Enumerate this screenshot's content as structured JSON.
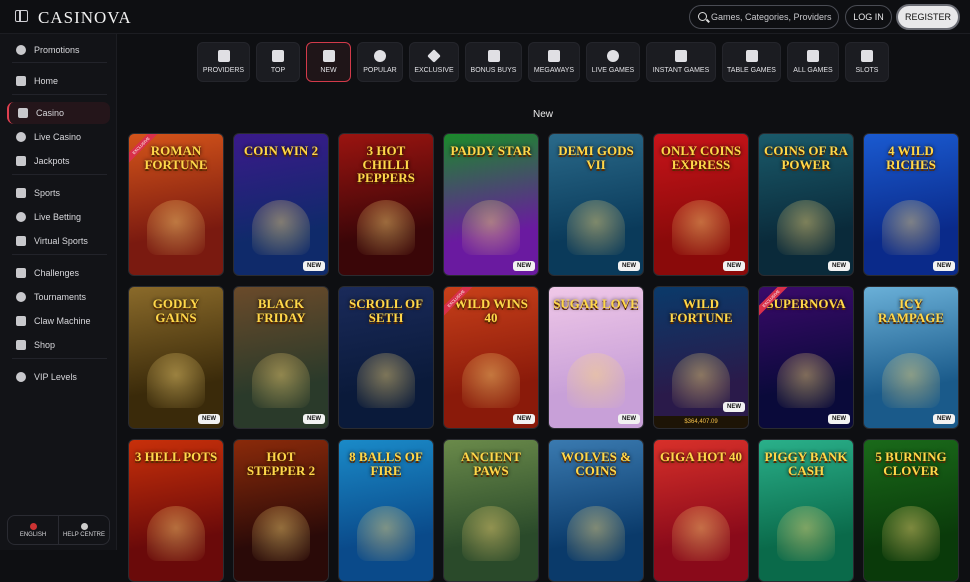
{
  "header": {
    "logo": "CASINOVA",
    "search_placeholder": "Games, Categories, Providers",
    "login": "LOG IN",
    "register": "REGISTER"
  },
  "sidebar": {
    "items": [
      {
        "label": "Promotions",
        "icon": "gift-icon"
      },
      {
        "label": "Home",
        "icon": "home-icon"
      },
      {
        "label": "Casino",
        "icon": "cards-icon",
        "active": true
      },
      {
        "label": "Live Casino",
        "icon": "live-casino-icon"
      },
      {
        "label": "Jackpots",
        "icon": "clover-icon"
      },
      {
        "label": "Sports",
        "icon": "soccer-ball-icon"
      },
      {
        "label": "Live Betting",
        "icon": "live-betting-icon"
      },
      {
        "label": "Virtual Sports",
        "icon": "virtual-sports-icon"
      },
      {
        "label": "Challenges",
        "icon": "medal-icon"
      },
      {
        "label": "Tournaments",
        "icon": "trophy-icon"
      },
      {
        "label": "Claw Machine",
        "icon": "claw-icon"
      },
      {
        "label": "Shop",
        "icon": "shop-icon"
      },
      {
        "label": "VIP Levels",
        "icon": "crown-icon"
      }
    ],
    "footer": {
      "language": "ENGLISH",
      "help": "HELP CENTRE"
    }
  },
  "categories": [
    {
      "label": "PROVIDERS",
      "icon": "providers-icon"
    },
    {
      "label": "TOP",
      "icon": "bow-icon"
    },
    {
      "label": "NEW",
      "icon": "lightning-icon",
      "active": true
    },
    {
      "label": "POPULAR",
      "icon": "flame-icon"
    },
    {
      "label": "EXCLUSIVE",
      "icon": "diamond-icon"
    },
    {
      "label": "BONUS BUYS",
      "icon": "gift-box-icon"
    },
    {
      "label": "MEGAWAYS",
      "icon": "m-icon"
    },
    {
      "label": "LIVE GAMES",
      "icon": "play-icon"
    },
    {
      "label": "INSTANT GAMES",
      "icon": "joystick-icon"
    },
    {
      "label": "TABLE GAMES",
      "icon": "card-deck-icon"
    },
    {
      "label": "ALL GAMES",
      "icon": "grid-icon"
    },
    {
      "label": "SLOTS",
      "icon": "sevens-icon"
    }
  ],
  "section_title": "New",
  "games": [
    {
      "name": "ROMAN FORTUNE",
      "badge": "",
      "exclusive": "EXCLUSIVE",
      "bg": "#7a1a10",
      "bg2": "#d4541a"
    },
    {
      "name": "COIN WIN 2",
      "badge": "NEW",
      "exclusive": "",
      "bg": "#0f2a6a",
      "bg2": "#3a1a8a"
    },
    {
      "name": "3 HOT CHILLI PEPPERS",
      "badge": "",
      "exclusive": "",
      "bg": "#3a0608",
      "bg2": "#9a1410"
    },
    {
      "name": "PADDY STAR",
      "badge": "NEW",
      "exclusive": "",
      "bg": "#6a1aa0",
      "bg2": "#1a8a2a"
    },
    {
      "name": "DEMI GODS VII",
      "badge": "NEW",
      "exclusive": "",
      "bg": "#0a3a5a",
      "bg2": "#2a6a8a"
    },
    {
      "name": "ONLY COINS EXPRESS",
      "badge": "NEW",
      "exclusive": "",
      "bg": "#8a0a0a",
      "bg2": "#c8141a"
    },
    {
      "name": "COINS OF RA POWER",
      "badge": "NEW",
      "exclusive": "",
      "bg": "#0a2a3a",
      "bg2": "#1a5a6a"
    },
    {
      "name": "4 WILD RICHES",
      "badge": "NEW",
      "exclusive": "",
      "bg": "#0a2a8a",
      "bg2": "#1a5ad0"
    },
    {
      "name": "GODLY GAINS",
      "badge": "NEW",
      "exclusive": "",
      "bg": "#3a2a0a",
      "bg2": "#8a6a2a"
    },
    {
      "name": "BLACK FRIDAY",
      "badge": "NEW",
      "exclusive": "",
      "bg": "#2a3a2a",
      "bg2": "#6a4a2a"
    },
    {
      "name": "SCROLL OF SETH",
      "badge": "",
      "exclusive": "",
      "bg": "#0a1a3a",
      "bg2": "#1a2a5a"
    },
    {
      "name": "WILD WINS 40",
      "badge": "NEW",
      "exclusive": "EXCLUSIVE",
      "bg": "#8a1a0a",
      "bg2": "#c8401a"
    },
    {
      "name": "SUGAR LOVE",
      "badge": "NEW",
      "exclusive": "",
      "bg": "#c8a0d8",
      "bg2": "#f0c8e8"
    },
    {
      "name": "WILD FORTUNE",
      "badge": "NEW",
      "exclusive": "",
      "bg": "#2a1a4a",
      "bg2": "#0a3a6a",
      "jackpot": "$364,407.09"
    },
    {
      "name": "SUPERNOVA",
      "badge": "NEW",
      "exclusive": "EXCLUSIVE",
      "bg": "#0a0a3a",
      "bg2": "#3a0a6a"
    },
    {
      "name": "ICY RAMPAGE",
      "badge": "NEW",
      "exclusive": "",
      "bg": "#1a5a8a",
      "bg2": "#6ab0d8"
    },
    {
      "name": "3 HELL POTS",
      "badge": "",
      "exclusive": "",
      "bg": "#6a0a0a",
      "bg2": "#c8300a"
    },
    {
      "name": "HOT STEPPER 2",
      "badge": "",
      "exclusive": "",
      "bg": "#2a0a08",
      "bg2": "#8a2a0a"
    },
    {
      "name": "8 BALLS OF FIRE",
      "badge": "",
      "exclusive": "",
      "bg": "#0a4a8a",
      "bg2": "#1a8ac8"
    },
    {
      "name": "ANCIENT PAWS",
      "badge": "",
      "exclusive": "",
      "bg": "#2a4a2a",
      "bg2": "#6a8a4a"
    },
    {
      "name": "WOLVES & COINS",
      "badge": "",
      "exclusive": "",
      "bg": "#0a3a6a",
      "bg2": "#3a7ab0"
    },
    {
      "name": "GIGA HOT 40",
      "badge": "",
      "exclusive": "",
      "bg": "#8a0a1a",
      "bg2": "#d8302a"
    },
    {
      "name": "PIGGY BANK CASH",
      "badge": "",
      "exclusive": "",
      "bg": "#0a6a4a",
      "bg2": "#2ab08a"
    },
    {
      "name": "5 BURNING CLOVER",
      "badge": "",
      "exclusive": "",
      "bg": "#0a3a0a",
      "bg2": "#1a6a1a"
    }
  ]
}
